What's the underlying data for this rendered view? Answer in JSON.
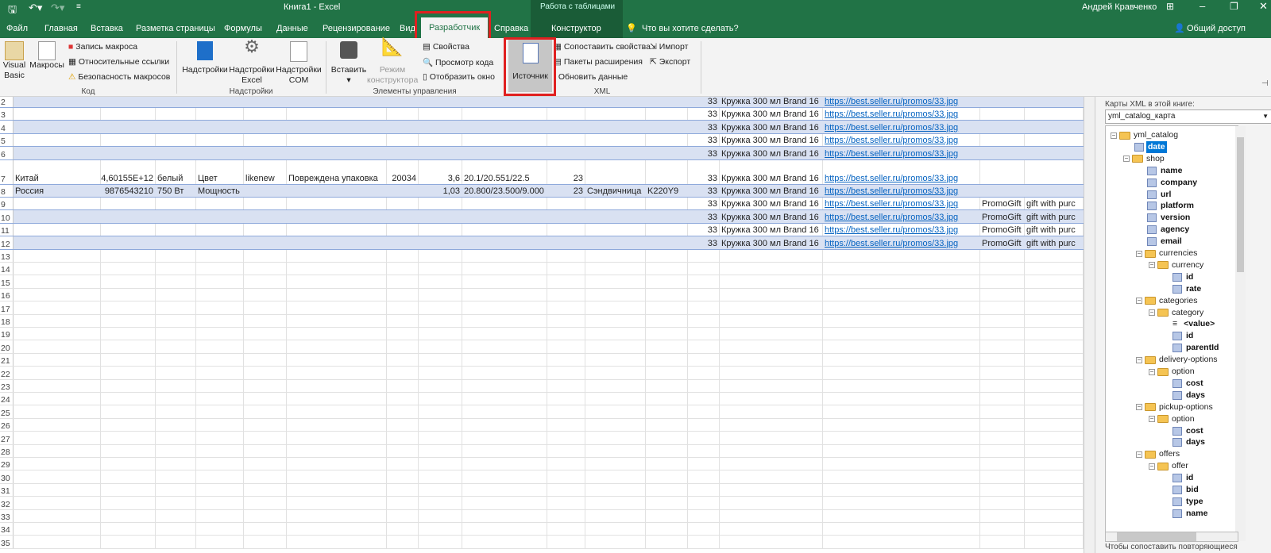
{
  "titlebar": {
    "title": "Книга1  -  Excel",
    "context_group": "Работа с таблицами",
    "user": "Андрей Кравченко",
    "share": "Общий доступ"
  },
  "tabs": [
    "Файл",
    "Главная",
    "Вставка",
    "Разметка страницы",
    "Формулы",
    "Данные",
    "Рецензирование",
    "Вид",
    "Разработчик",
    "Справка",
    "Конструктор"
  ],
  "tell_me": "Что вы хотите сделать?",
  "ribbon": {
    "code": {
      "label": "Код",
      "visual_basic": "Visual Basic",
      "macros": "Макросы",
      "record": "Запись макроса",
      "relative": "Относительные ссылки",
      "security": "Безопасность макросов"
    },
    "addins": {
      "label": "Надстройки",
      "addins": "Надстройки",
      "excel": "Надстройки Excel",
      "com": "Надстройки COM"
    },
    "controls": {
      "label": "Элементы управления",
      "insert": "Вставить",
      "design": "Режим конструктора",
      "properties": "Свойства",
      "view_code": "Просмотр кода",
      "dialog": "Отобразить окно"
    },
    "xml": {
      "label": "XML",
      "source": "Источник",
      "map_props": "Сопоставить свойства",
      "packs": "Пакеты расширения",
      "refresh": "Обновить данные",
      "import": "Импорт",
      "export": "Экспорт"
    }
  },
  "grid": {
    "rows": [
      {
        "n": "2",
        "cells": {
          "M": "33",
          "N": "Кружка 300 мл Brand 16",
          "O": "https://best.seller.ru/promos/33.jpg"
        }
      },
      {
        "n": "3",
        "cells": {
          "M": "33",
          "N": "Кружка 300 мл Brand 16",
          "O": "https://best.seller.ru/promos/33.jpg"
        }
      },
      {
        "n": "4",
        "cells": {
          "M": "33",
          "N": "Кружка 300 мл Brand 16",
          "O": "https://best.seller.ru/promos/33.jpg"
        }
      },
      {
        "n": "5",
        "cells": {
          "M": "33",
          "N": "Кружка 300 мл Brand 16",
          "O": "https://best.seller.ru/promos/33.jpg"
        }
      },
      {
        "n": "6",
        "cells": {
          "M": "33",
          "N": "Кружка 300 мл Brand 16",
          "O": "https://best.seller.ru/promos/33.jpg"
        }
      },
      {
        "n": "7",
        "cells": {
          "A": "Китай",
          "B": "4,60155E+12",
          "C": "белый",
          "D": "Цвет",
          "E": "likenew",
          "F": "Повреждена упаковка",
          "G": "20034",
          "H": "3,6",
          "I": "20.1/20.551/22.5",
          "J": "23",
          "M": "33",
          "N": "Кружка 300 мл Brand 16",
          "O": "https://best.seller.ru/promos/33.jpg"
        }
      },
      {
        "n": "8",
        "cells": {
          "A": "Россия",
          "B": "9876543210",
          "C": "750 Вт",
          "D": "Мощность",
          "H": "1,03",
          "I": "20.800/23.500/9.000",
          "J": "23",
          "K": "Сэндвичница",
          "L": "K220Y9",
          "M": "33",
          "N": "Кружка 300 мл Brand 16",
          "O": "https://best.seller.ru/promos/33.jpg"
        }
      },
      {
        "n": "9",
        "cells": {
          "M": "33",
          "N": "Кружка 300 мл Brand 16",
          "O": "https://best.seller.ru/promos/33.jpg",
          "P": "PromoGift",
          "Q": "gift with purc"
        }
      },
      {
        "n": "10",
        "cells": {
          "M": "33",
          "N": "Кружка 300 мл Brand 16",
          "O": "https://best.seller.ru/promos/33.jpg",
          "P": "PromoGift",
          "Q": "gift with purc"
        }
      },
      {
        "n": "11",
        "cells": {
          "M": "33",
          "N": "Кружка 300 мл Brand 16",
          "O": "https://best.seller.ru/promos/33.jpg",
          "P": "PromoGift",
          "Q": "gift with purc"
        }
      },
      {
        "n": "12",
        "cells": {
          "M": "33",
          "N": "Кружка 300 мл Brand 16",
          "O": "https://best.seller.ru/promos/33.jpg",
          "P": "PromoGift",
          "Q": "gift with purc"
        }
      }
    ],
    "empty_rows": [
      "13",
      "14",
      "15",
      "16",
      "17",
      "18",
      "19",
      "20",
      "21",
      "22",
      "23",
      "24",
      "25",
      "26",
      "27",
      "28",
      "29",
      "30",
      "31",
      "32",
      "33",
      "34",
      "35"
    ]
  },
  "xml_pane": {
    "maps_label": "Карты XML в этой книге:",
    "selected_map": "yml_catalog_карта",
    "tree": [
      {
        "t": "yml_catalog",
        "l": 0,
        "k": "root"
      },
      {
        "t": "date",
        "l": 1,
        "k": "leaf",
        "sel": true
      },
      {
        "t": "shop",
        "l": 1,
        "k": "folder"
      },
      {
        "t": "name",
        "l": 2,
        "k": "leaf"
      },
      {
        "t": "company",
        "l": 2,
        "k": "leaf"
      },
      {
        "t": "url",
        "l": 2,
        "k": "leaf"
      },
      {
        "t": "platform",
        "l": 2,
        "k": "leaf"
      },
      {
        "t": "version",
        "l": 2,
        "k": "leaf"
      },
      {
        "t": "agency",
        "l": 2,
        "k": "leaf"
      },
      {
        "t": "email",
        "l": 2,
        "k": "leaf"
      },
      {
        "t": "currencies",
        "l": 2,
        "k": "folder"
      },
      {
        "t": "currency",
        "l": 3,
        "k": "folder"
      },
      {
        "t": "id",
        "l": 4,
        "k": "leaf"
      },
      {
        "t": "rate",
        "l": 4,
        "k": "leaf"
      },
      {
        "t": "categories",
        "l": 2,
        "k": "folder"
      },
      {
        "t": "category",
        "l": 3,
        "k": "folder"
      },
      {
        "t": "<value>",
        "l": 4,
        "k": "value"
      },
      {
        "t": "id",
        "l": 4,
        "k": "leaf"
      },
      {
        "t": "parentId",
        "l": 4,
        "k": "leaf"
      },
      {
        "t": "delivery-options",
        "l": 2,
        "k": "folder"
      },
      {
        "t": "option",
        "l": 3,
        "k": "folder"
      },
      {
        "t": "cost",
        "l": 4,
        "k": "leaf"
      },
      {
        "t": "days",
        "l": 4,
        "k": "leaf"
      },
      {
        "t": "pickup-options",
        "l": 2,
        "k": "folder"
      },
      {
        "t": "option",
        "l": 3,
        "k": "folder"
      },
      {
        "t": "cost",
        "l": 4,
        "k": "leaf"
      },
      {
        "t": "days",
        "l": 4,
        "k": "leaf"
      },
      {
        "t": "offers",
        "l": 2,
        "k": "folder"
      },
      {
        "t": "offer",
        "l": 3,
        "k": "folder"
      },
      {
        "t": "id",
        "l": 4,
        "k": "leaf"
      },
      {
        "t": "bid",
        "l": 4,
        "k": "leaf"
      },
      {
        "t": "type",
        "l": 4,
        "k": "leaf"
      },
      {
        "t": "name",
        "l": 4,
        "k": "leaf"
      }
    ],
    "hint": "Чтобы сопоставить повторяющиеся"
  },
  "colors": {
    "accent": "#217346",
    "band": "#d9e1f2",
    "table_border": "#8ea9db",
    "link": "#0563c1",
    "highlight": "#e02020"
  }
}
